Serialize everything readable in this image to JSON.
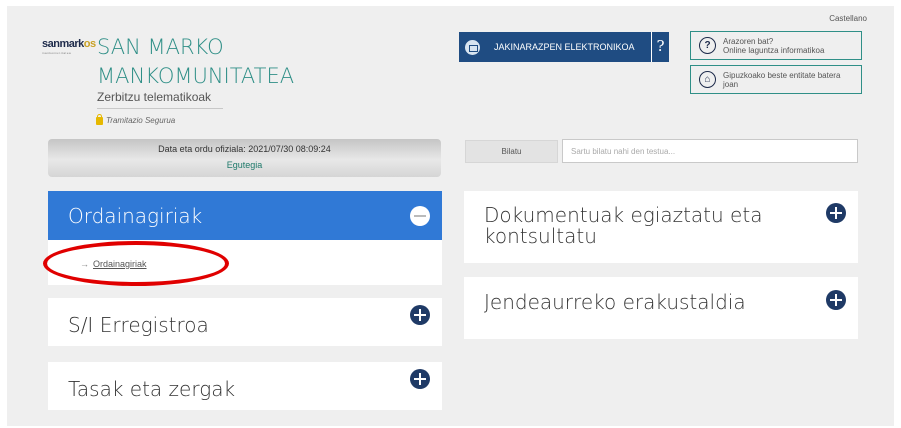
{
  "header": {
    "language": "Castellano",
    "logo_text_main": "sanmark",
    "logo_text_accent": "os",
    "logo_subtext": "mankomunitatea",
    "org_title_line1": "SAN MARKO",
    "org_title_line2": "MANKOMUNITATEA",
    "org_subtitle": "Zerbitzu telematikoak",
    "secure_label": "Tramitazio Segurua"
  },
  "notifications": {
    "label": "JAKINARAZPEN ELEKTRONIKOA",
    "help": "?",
    "icon": "envelope-icon"
  },
  "info_boxes": [
    {
      "icon": "question-icon",
      "glyph": "?",
      "line1": "Arazoren bat?",
      "line2": "Online laguntza informatikoa"
    },
    {
      "icon": "building-icon",
      "glyph": "⌂",
      "line1": "Gipuzkoako beste entitate batera",
      "line2": "joan"
    }
  ],
  "date_bar": {
    "official_time": "Data eta ordu ofiziala: 2021/07/30 08:09:24",
    "calendar_link": "Egutegia"
  },
  "search": {
    "label": "Bilatu",
    "placeholder": "Sartu bilatu nahi den testua..."
  },
  "cards": {
    "ordainagiriak": {
      "title": "Ordainagiriak",
      "sublink": "Ordainagiriak",
      "state": "expanded"
    },
    "erregistroa": {
      "title": "S/I Erregistroa"
    },
    "tasak": {
      "title": "Tasak eta zergak"
    },
    "dokumentuak": {
      "title": "Dokumentuak egiaztatu eta kontsultatu"
    },
    "jendeaurreko": {
      "title": "Jendeaurreko erakustaldia"
    }
  },
  "colors": {
    "accent_blue": "#3079d6",
    "dark_navy": "#1f3a66",
    "teal": "#2f8f87",
    "highlight_red": "#e00000"
  }
}
